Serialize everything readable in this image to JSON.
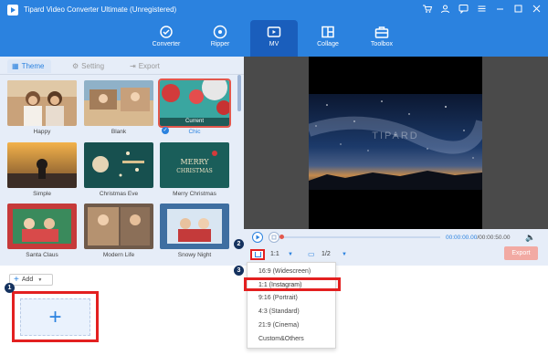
{
  "app": {
    "title": "Tipard Video Converter Ultimate (Unregistered)",
    "window_icons": [
      "cart-icon",
      "user-icon",
      "chat-icon",
      "menu-icon",
      "minimize-icon",
      "maximize-icon",
      "close-icon"
    ]
  },
  "nav": {
    "items": [
      {
        "label": "Converter",
        "icon": "converter-icon"
      },
      {
        "label": "Ripper",
        "icon": "ripper-icon"
      },
      {
        "label": "MV",
        "icon": "mv-icon",
        "active": true
      },
      {
        "label": "Collage",
        "icon": "collage-icon"
      },
      {
        "label": "Toolbox",
        "icon": "toolbox-icon"
      }
    ]
  },
  "tabs": [
    {
      "label": "Theme",
      "active": true
    },
    {
      "label": "Setting"
    },
    {
      "label": "Export"
    }
  ],
  "themes": [
    {
      "name": "Happy"
    },
    {
      "name": "Blank"
    },
    {
      "name": "Chic",
      "selected": true,
      "badge": "Current"
    },
    {
      "name": "Simple"
    },
    {
      "name": "Christmas Eve"
    },
    {
      "name": "Merry Christmas"
    },
    {
      "name": "Santa Claus"
    },
    {
      "name": "Modern Life"
    },
    {
      "name": "Snowy Night"
    }
  ],
  "add": {
    "label": "Add"
  },
  "steps": [
    "1",
    "2",
    "3"
  ],
  "preview": {
    "watermark": "TIPARD"
  },
  "player": {
    "current_time": "00:00:00.00",
    "total_time": "/00:00:50.00",
    "ratio": "1:1",
    "page": "1/2",
    "export_label": "Export"
  },
  "ratio_menu": [
    "16:9 (Widescreen)",
    "1:1 (Instagram)",
    "9:16 (Portrait)",
    "4:3 (Standard)",
    "21:9 (Cinema)",
    "Custom&Others"
  ],
  "colors": {
    "brand": "#2b82df",
    "highlight": "#e32020",
    "export": "#f2aaa3"
  }
}
